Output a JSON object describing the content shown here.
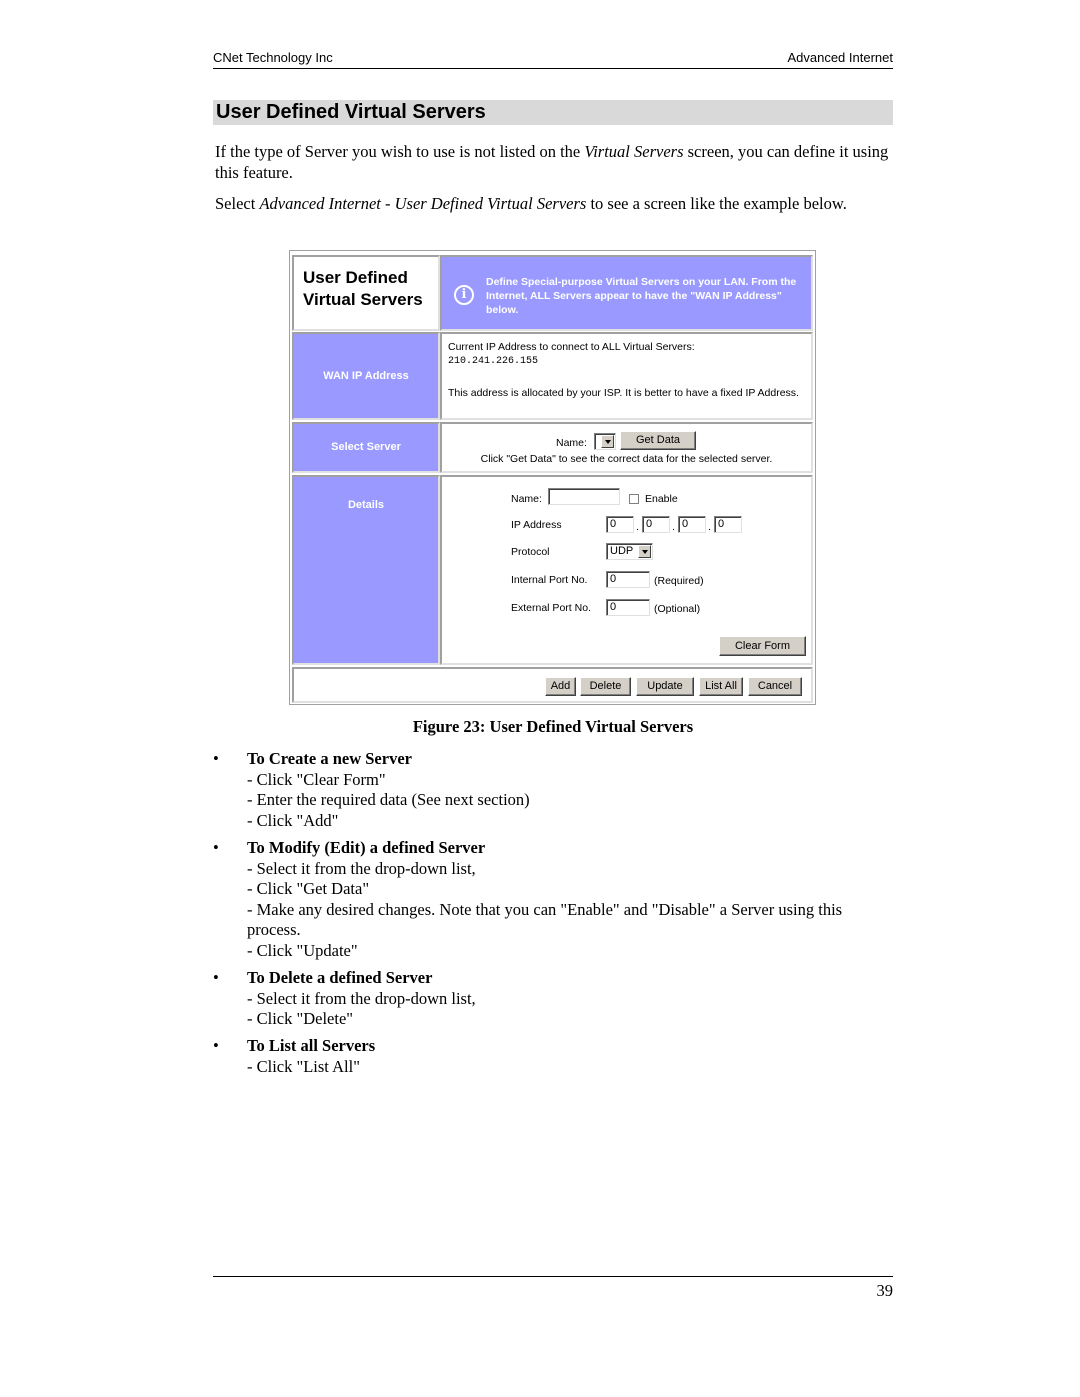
{
  "header": {
    "left": "CNet Technology Inc",
    "right": "Advanced Internet"
  },
  "section_title": "User Defined Virtual Servers",
  "intro": {
    "p1_before": "If the type of Server you wish to use is not listed on the ",
    "p1_italic": "Virtual Servers",
    "p1_after": " screen, you can define it using this feature.",
    "p2_before": "Select ",
    "p2_italic": "Advanced Internet - User Defined Virtual Servers",
    "p2_after": " to see a screen like the example below."
  },
  "screenshot": {
    "title_line1": "User Defined",
    "title_line2": "Virtual Servers",
    "info_icon": "info-icon",
    "info_text": "Define Special-purpose Virtual Servers on your LAN. From the Internet, ALL Servers appear to have the \"WAN IP Address\" below.",
    "wan": {
      "label": "WAN IP Address",
      "line1": "Current IP Address to connect to ALL Virtual Servers:",
      "ip": "210.241.226.155",
      "note": "This address is allocated by your ISP. It is better to have a fixed IP Address."
    },
    "select": {
      "label": "Select Server",
      "name_label": "Name:",
      "name_value": "",
      "get_data": "Get Data",
      "hint": "Click \"Get Data\" to see the correct data for the selected server."
    },
    "details": {
      "label": "Details",
      "name_label": "Name:",
      "name_value": "",
      "enable_label": "Enable",
      "enable_checked": false,
      "ip_label": "IP Address",
      "ip_octets": [
        "0",
        "0",
        "0",
        "0"
      ],
      "ip_separator": ".",
      "protocol_label": "Protocol",
      "protocol_value": "UDP",
      "internal_label": "Internal Port No.",
      "internal_value": "0",
      "internal_note": "(Required)",
      "external_label": "External Port No.",
      "external_value": "0",
      "external_note": "(Optional)",
      "clear_form": "Clear Form"
    },
    "actions": [
      "Add",
      "Delete",
      "Update",
      "List All",
      "Cancel"
    ],
    "colors": {
      "panel_blue": "#9999ff"
    }
  },
  "caption": "Figure 23: User Defined Virtual Servers",
  "bullets": [
    {
      "head": "To Create a new Server",
      "lines": [
        "- Click \"Clear Form\"",
        "- Enter the required data (See next section)",
        "- Click \"Add\""
      ]
    },
    {
      "head": "To Modify (Edit) a defined Server",
      "lines": [
        "- Select it from the drop-down list,",
        "- Click \"Get Data\"",
        "- Make any desired changes. Note that you can \"Enable\" and \"Disable\" a Server using this process.",
        "- Click \"Update\""
      ]
    },
    {
      "head": "To Delete a defined Server",
      "lines": [
        "- Select it from the drop-down list,",
        "- Click \"Delete\""
      ]
    },
    {
      "head": "To List all Servers",
      "lines": [
        "- Click \"List All\""
      ]
    }
  ],
  "bullet_glyph": "•",
  "page_number": "39"
}
